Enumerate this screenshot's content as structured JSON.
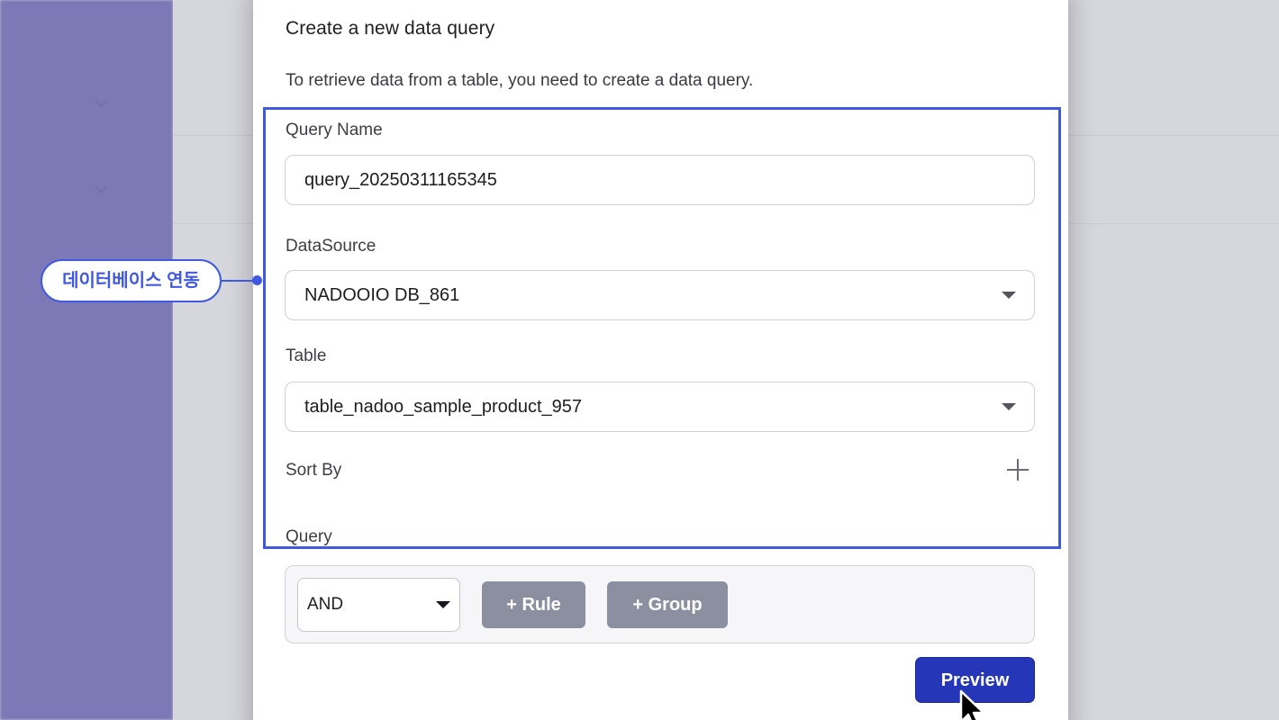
{
  "modal": {
    "title": "Create a new data query",
    "subtitle": "To retrieve data from a table, you need to create a data query."
  },
  "form": {
    "query_name_label": "Query Name",
    "query_name_value": "query_20250311165345",
    "datasource_label": "DataSource",
    "datasource_value": "NADOOIO DB_861",
    "table_label": "Table",
    "table_value": "table_nadoo_sample_product_957",
    "sort_by_label": "Sort By",
    "query_label": "Query"
  },
  "query_builder": {
    "combinator_value": "AND",
    "add_rule_label": "+ Rule",
    "add_group_label": "+ Group"
  },
  "actions": {
    "preview_label": "Preview"
  },
  "annotation": {
    "callout_text": "데이터베이스 연동",
    "accent_color": "#3f5ae0"
  },
  "colors": {
    "sidebar": "#7d79b7",
    "primary_button": "#2536b8",
    "secondary_button": "#8c8f9f"
  },
  "icons": [
    "chevron-down-icon",
    "dropdown-caret-icon",
    "plus-icon",
    "mouse-cursor-icon"
  ]
}
